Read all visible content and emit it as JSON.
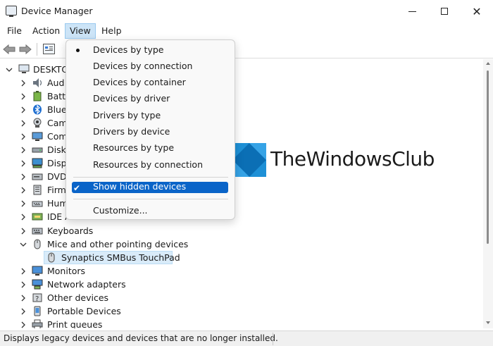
{
  "window": {
    "title": "Device Manager"
  },
  "menubar": {
    "file": "File",
    "action": "Action",
    "view": "View",
    "help": "Help"
  },
  "tree": {
    "root": "DESKTO",
    "items": [
      {
        "label": "Aud",
        "icon": "audio-icon"
      },
      {
        "label": "Batt",
        "icon": "battery-icon"
      },
      {
        "label": "Blue",
        "icon": "bluetooth-icon"
      },
      {
        "label": "Cam",
        "icon": "camera-icon"
      },
      {
        "label": "Com",
        "icon": "computer-icon"
      },
      {
        "label": "Disk",
        "icon": "disk-drive-icon"
      },
      {
        "label": "Disp",
        "icon": "display-adapter-icon"
      },
      {
        "label": "DVD",
        "icon": "dvd-drive-icon"
      },
      {
        "label": "Firm",
        "icon": "firmware-icon"
      },
      {
        "label": "Hum",
        "icon": "hid-icon"
      },
      {
        "label": "IDE A",
        "icon": "ide-controller-icon"
      },
      {
        "label": "Keyboards",
        "icon": "keyboard-icon"
      },
      {
        "label": "Mice and other pointing devices",
        "icon": "mouse-icon",
        "expanded": true
      },
      {
        "label": "Synaptics SMBus TouchPad",
        "icon": "mouse-icon",
        "child": true,
        "selected": true
      },
      {
        "label": "Monitors",
        "icon": "monitor-icon"
      },
      {
        "label": "Network adapters",
        "icon": "network-adapter-icon"
      },
      {
        "label": "Other devices",
        "icon": "other-devices-icon"
      },
      {
        "label": "Portable Devices",
        "icon": "portable-device-icon"
      },
      {
        "label": "Print queues",
        "icon": "printer-icon"
      }
    ]
  },
  "view_menu": {
    "items": [
      {
        "label": "Devices by type",
        "bullet": true
      },
      {
        "label": "Devices by connection"
      },
      {
        "label": "Devices by container"
      },
      {
        "label": "Devices by driver"
      },
      {
        "label": "Drivers by type"
      },
      {
        "label": "Drivers by device"
      },
      {
        "label": "Resources by type"
      },
      {
        "label": "Resources by connection"
      },
      {
        "label": "Show hidden devices",
        "checked": true,
        "highlighted": true
      },
      {
        "label": "Customize..."
      }
    ]
  },
  "status": {
    "text": "Displays legacy devices and devices that are no longer installed."
  },
  "watermark": {
    "text": "TheWindowsClub"
  },
  "colors": {
    "highlight": "#0a64c8",
    "selection": "#d9ebf9",
    "logo": "#1e90d6"
  }
}
